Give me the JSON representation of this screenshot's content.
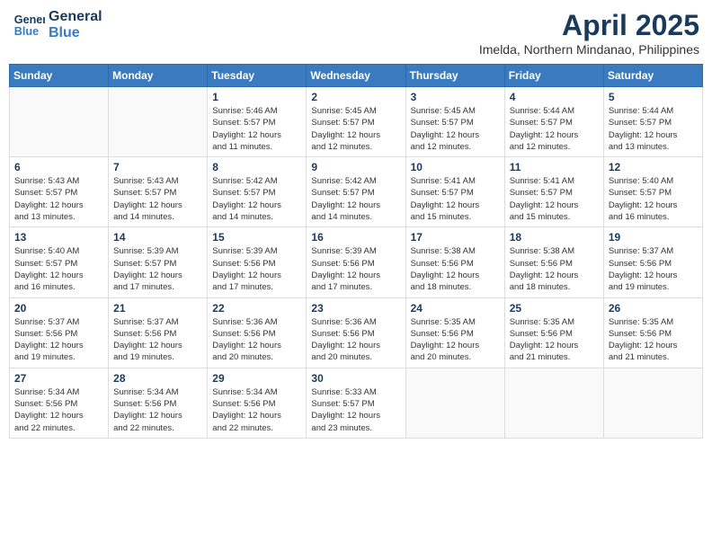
{
  "logo": {
    "line1": "General",
    "line2": "Blue"
  },
  "title": "April 2025",
  "location": "Imelda, Northern Mindanao, Philippines",
  "days_header": [
    "Sunday",
    "Monday",
    "Tuesday",
    "Wednesday",
    "Thursday",
    "Friday",
    "Saturday"
  ],
  "weeks": [
    [
      {
        "num": "",
        "info": ""
      },
      {
        "num": "",
        "info": ""
      },
      {
        "num": "1",
        "info": "Sunrise: 5:46 AM\nSunset: 5:57 PM\nDaylight: 12 hours\nand 11 minutes."
      },
      {
        "num": "2",
        "info": "Sunrise: 5:45 AM\nSunset: 5:57 PM\nDaylight: 12 hours\nand 12 minutes."
      },
      {
        "num": "3",
        "info": "Sunrise: 5:45 AM\nSunset: 5:57 PM\nDaylight: 12 hours\nand 12 minutes."
      },
      {
        "num": "4",
        "info": "Sunrise: 5:44 AM\nSunset: 5:57 PM\nDaylight: 12 hours\nand 12 minutes."
      },
      {
        "num": "5",
        "info": "Sunrise: 5:44 AM\nSunset: 5:57 PM\nDaylight: 12 hours\nand 13 minutes."
      }
    ],
    [
      {
        "num": "6",
        "info": "Sunrise: 5:43 AM\nSunset: 5:57 PM\nDaylight: 12 hours\nand 13 minutes."
      },
      {
        "num": "7",
        "info": "Sunrise: 5:43 AM\nSunset: 5:57 PM\nDaylight: 12 hours\nand 14 minutes."
      },
      {
        "num": "8",
        "info": "Sunrise: 5:42 AM\nSunset: 5:57 PM\nDaylight: 12 hours\nand 14 minutes."
      },
      {
        "num": "9",
        "info": "Sunrise: 5:42 AM\nSunset: 5:57 PM\nDaylight: 12 hours\nand 14 minutes."
      },
      {
        "num": "10",
        "info": "Sunrise: 5:41 AM\nSunset: 5:57 PM\nDaylight: 12 hours\nand 15 minutes."
      },
      {
        "num": "11",
        "info": "Sunrise: 5:41 AM\nSunset: 5:57 PM\nDaylight: 12 hours\nand 15 minutes."
      },
      {
        "num": "12",
        "info": "Sunrise: 5:40 AM\nSunset: 5:57 PM\nDaylight: 12 hours\nand 16 minutes."
      }
    ],
    [
      {
        "num": "13",
        "info": "Sunrise: 5:40 AM\nSunset: 5:57 PM\nDaylight: 12 hours\nand 16 minutes."
      },
      {
        "num": "14",
        "info": "Sunrise: 5:39 AM\nSunset: 5:57 PM\nDaylight: 12 hours\nand 17 minutes."
      },
      {
        "num": "15",
        "info": "Sunrise: 5:39 AM\nSunset: 5:56 PM\nDaylight: 12 hours\nand 17 minutes."
      },
      {
        "num": "16",
        "info": "Sunrise: 5:39 AM\nSunset: 5:56 PM\nDaylight: 12 hours\nand 17 minutes."
      },
      {
        "num": "17",
        "info": "Sunrise: 5:38 AM\nSunset: 5:56 PM\nDaylight: 12 hours\nand 18 minutes."
      },
      {
        "num": "18",
        "info": "Sunrise: 5:38 AM\nSunset: 5:56 PM\nDaylight: 12 hours\nand 18 minutes."
      },
      {
        "num": "19",
        "info": "Sunrise: 5:37 AM\nSunset: 5:56 PM\nDaylight: 12 hours\nand 19 minutes."
      }
    ],
    [
      {
        "num": "20",
        "info": "Sunrise: 5:37 AM\nSunset: 5:56 PM\nDaylight: 12 hours\nand 19 minutes."
      },
      {
        "num": "21",
        "info": "Sunrise: 5:37 AM\nSunset: 5:56 PM\nDaylight: 12 hours\nand 19 minutes."
      },
      {
        "num": "22",
        "info": "Sunrise: 5:36 AM\nSunset: 5:56 PM\nDaylight: 12 hours\nand 20 minutes."
      },
      {
        "num": "23",
        "info": "Sunrise: 5:36 AM\nSunset: 5:56 PM\nDaylight: 12 hours\nand 20 minutes."
      },
      {
        "num": "24",
        "info": "Sunrise: 5:35 AM\nSunset: 5:56 PM\nDaylight: 12 hours\nand 20 minutes."
      },
      {
        "num": "25",
        "info": "Sunrise: 5:35 AM\nSunset: 5:56 PM\nDaylight: 12 hours\nand 21 minutes."
      },
      {
        "num": "26",
        "info": "Sunrise: 5:35 AM\nSunset: 5:56 PM\nDaylight: 12 hours\nand 21 minutes."
      }
    ],
    [
      {
        "num": "27",
        "info": "Sunrise: 5:34 AM\nSunset: 5:56 PM\nDaylight: 12 hours\nand 22 minutes."
      },
      {
        "num": "28",
        "info": "Sunrise: 5:34 AM\nSunset: 5:56 PM\nDaylight: 12 hours\nand 22 minutes."
      },
      {
        "num": "29",
        "info": "Sunrise: 5:34 AM\nSunset: 5:56 PM\nDaylight: 12 hours\nand 22 minutes."
      },
      {
        "num": "30",
        "info": "Sunrise: 5:33 AM\nSunset: 5:57 PM\nDaylight: 12 hours\nand 23 minutes."
      },
      {
        "num": "",
        "info": ""
      },
      {
        "num": "",
        "info": ""
      },
      {
        "num": "",
        "info": ""
      }
    ]
  ]
}
